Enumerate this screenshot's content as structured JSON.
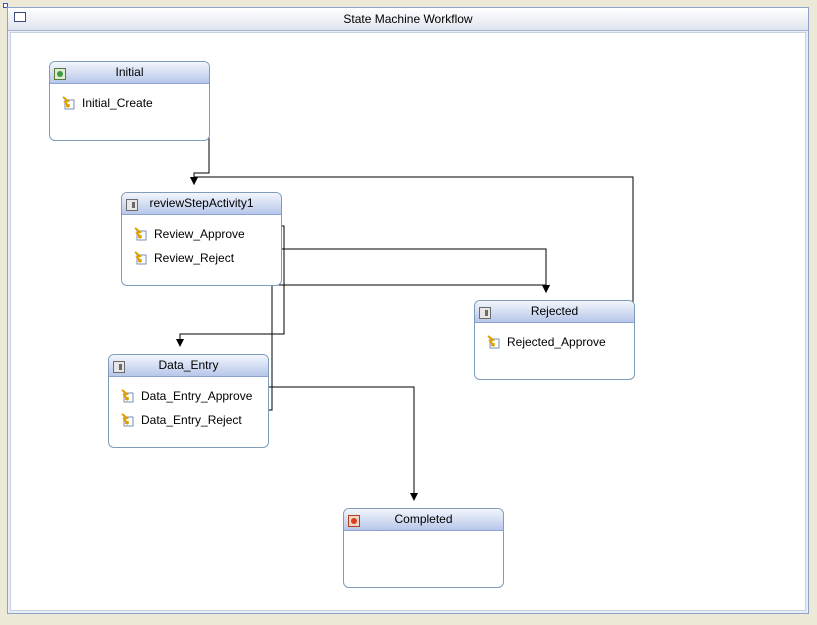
{
  "window": {
    "title": "State Machine Workflow"
  },
  "states": [
    {
      "id": "initial",
      "name": "Initial",
      "kind": "initial",
      "icon": "initial-state-icon",
      "events": [
        {
          "id": "initial_create",
          "label": "Initial_Create",
          "target": "review"
        }
      ]
    },
    {
      "id": "review",
      "name": "reviewStepActivity1",
      "kind": "state",
      "icon": "state-icon",
      "events": [
        {
          "id": "review_approve",
          "label": "Review_Approve",
          "target": "data_entry"
        },
        {
          "id": "review_reject",
          "label": "Review_Reject",
          "target": "rejected"
        }
      ]
    },
    {
      "id": "rejected",
      "name": "Rejected",
      "kind": "state",
      "icon": "state-icon",
      "events": [
        {
          "id": "rejected_approve",
          "label": "Rejected_Approve",
          "target": "review"
        }
      ]
    },
    {
      "id": "data_entry",
      "name": "Data_Entry",
      "kind": "state",
      "icon": "state-icon",
      "events": [
        {
          "id": "data_entry_approve",
          "label": "Data_Entry_Approve",
          "target": "completed"
        },
        {
          "id": "data_entry_reject",
          "label": "Data_Entry_Reject",
          "target": "rejected"
        }
      ]
    },
    {
      "id": "completed",
      "name": "Completed",
      "kind": "completed",
      "icon": "completed-state-icon",
      "events": []
    }
  ],
  "colors": {
    "connector": "#000000",
    "border": "#7f9db9",
    "header": "#b7c7ea",
    "frame": "#8da2c7"
  }
}
